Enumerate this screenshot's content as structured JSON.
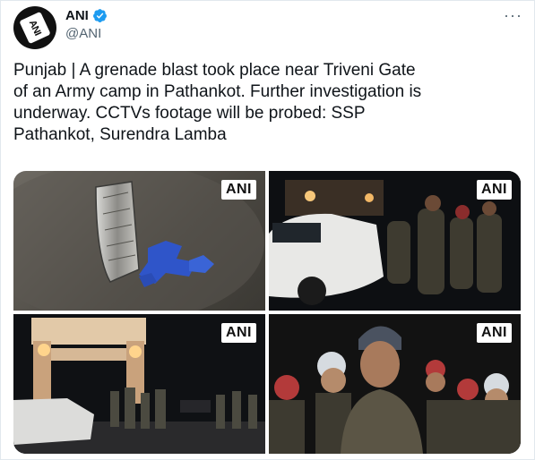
{
  "account": {
    "display_name": "ANI",
    "handle": "@ANI",
    "avatar_text": "ANI"
  },
  "menu": {
    "more_label": "···"
  },
  "tweet": {
    "text": "Punjab | A grenade blast took place near Triveni Gate\nof an Army camp in Pathankot. Further investigation is\nunderway. CCTVs footage will be probed: SSP\nPathankot, Surendra Lamba"
  },
  "media": {
    "watermark": "ANI",
    "photos": [
      {
        "watermark": "ANI"
      },
      {
        "watermark": "ANI"
      },
      {
        "watermark": "ANI"
      },
      {
        "watermark": "ANI"
      }
    ]
  },
  "colors": {
    "verified": "#1d9bf0",
    "text": "#0f1419",
    "secondary": "#536471"
  }
}
